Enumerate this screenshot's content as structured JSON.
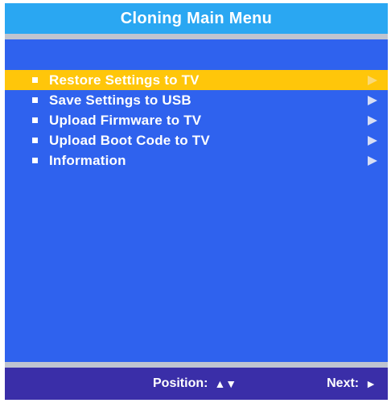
{
  "title": "Cloning Main Menu",
  "menu": {
    "items": [
      {
        "label": "Restore Settings to TV",
        "selected": true
      },
      {
        "label": "Save Settings to USB",
        "selected": false
      },
      {
        "label": "Upload Firmware to TV",
        "selected": false
      },
      {
        "label": "Upload Boot Code to TV",
        "selected": false
      },
      {
        "label": "Information",
        "selected": false
      }
    ]
  },
  "footer": {
    "position_label": "Position:",
    "position_glyph": "▲▼",
    "next_label": "Next:",
    "next_glyph": "►"
  },
  "colors": {
    "background": "#2f62ee",
    "title_bar": "#2aa7f2",
    "selection": "#ffc60a",
    "footer_bar": "#3a2ea8",
    "separator": "#bfc4d0"
  },
  "icons": {
    "bullet": "square-bullet-icon",
    "submenu": "play-arrow-icon",
    "position": "up-down-arrows-icon",
    "next": "right-arrow-icon"
  }
}
